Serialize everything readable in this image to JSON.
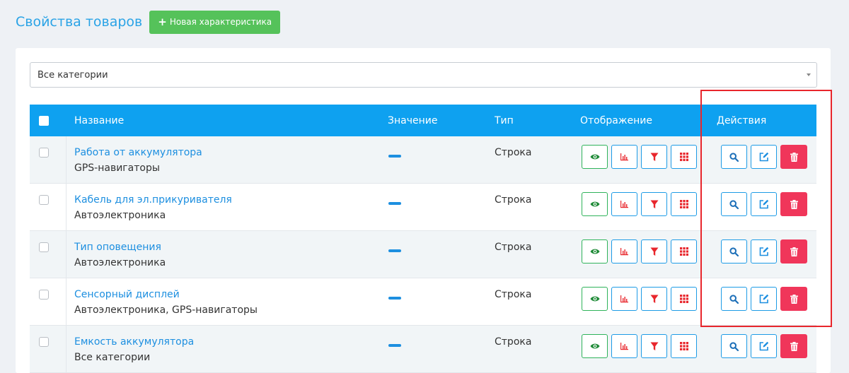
{
  "header": {
    "title": "Свойства товаров",
    "new_button_label": "Новая характеристика",
    "new_button_icon": "plus-icon"
  },
  "filter": {
    "selected": "Все категории"
  },
  "table": {
    "columns": {
      "name": "Название",
      "value": "Значение",
      "type": "Тип",
      "display": "Отображение",
      "actions": "Действия"
    },
    "rows": [
      {
        "name": "Работа от аккумулятора",
        "categories": "GPS-навигаторы",
        "value": "—",
        "type": "Строка"
      },
      {
        "name": "Кабель для эл.прикуривателя",
        "categories": "Автоэлектроника",
        "value": "—",
        "type": "Строка"
      },
      {
        "name": "Тип оповещения",
        "categories": "Автоэлектроника",
        "value": "—",
        "type": "Строка"
      },
      {
        "name": "Сенсорный дисплей",
        "categories": "Автоэлектроника, GPS-навигаторы",
        "value": "—",
        "type": "Строка"
      },
      {
        "name": "Емкость аккумулятора",
        "categories": "Все категории",
        "value": "—",
        "type": "Строка"
      }
    ]
  },
  "icons": {
    "display": [
      "eye-icon",
      "chart-icon",
      "filter-icon",
      "grid-icon"
    ],
    "actions": [
      "search-icon",
      "edit-icon",
      "trash-icon"
    ]
  },
  "colors": {
    "accent": "#0ea1f0",
    "link": "#1d8fe0",
    "success": "#55c25a",
    "danger": "#f0365a",
    "highlight": "#e8262c"
  }
}
